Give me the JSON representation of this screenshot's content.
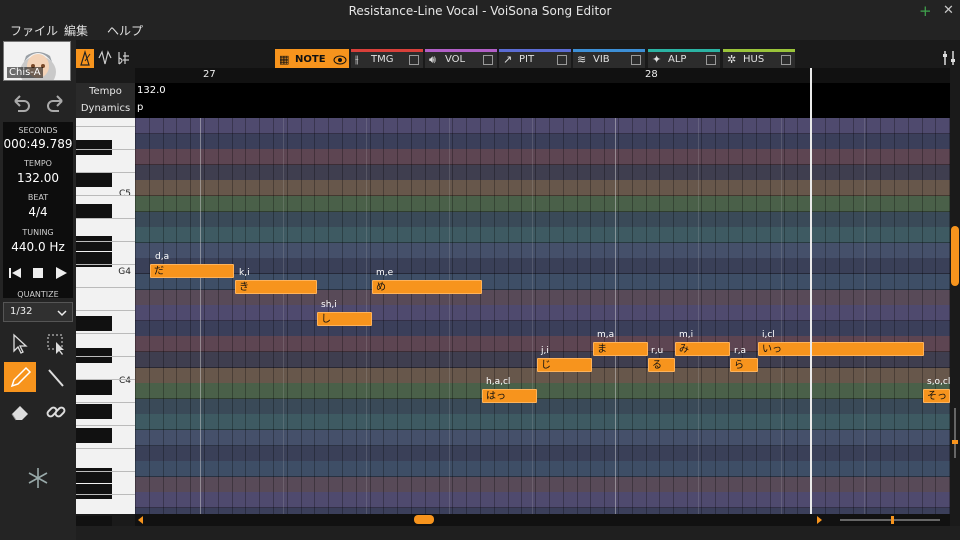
{
  "window": {
    "title": "Resistance-Line Vocal - VoiSona Song Editor",
    "minimize_glyph": "+",
    "close_glyph": "✕"
  },
  "menu": {
    "items": [
      "ファイル",
      "編集",
      "ヘルプ"
    ]
  },
  "singer": {
    "name": "Chis-A"
  },
  "info": {
    "seconds_label": "SECONDS",
    "seconds": "000:49.789",
    "tempo_label": "TEMPO",
    "tempo": "132.00",
    "beat_label": "BEAT",
    "beat": "4/4",
    "tuning_label": "TUNING",
    "tuning": "440.0 Hz"
  },
  "quantize": {
    "label": "QUANTIZE",
    "value": "1/32"
  },
  "tabs": [
    {
      "label": "NOTE",
      "color": "#f7941d"
    },
    {
      "label": "TMG",
      "color": "#d9403a"
    },
    {
      "label": "VOL",
      "color": "#b15fc7"
    },
    {
      "label": "PIT",
      "color": "#5b6cd4"
    },
    {
      "label": "VIB",
      "color": "#3d8fd6"
    },
    {
      "label": "ALP",
      "color": "#2bb3a3"
    },
    {
      "label": "HUS",
      "color": "#9ac43a"
    }
  ],
  "ruler": {
    "bars": [
      "27",
      "28"
    ]
  },
  "tracks": {
    "tempo_label": "Tempo",
    "tempo_value": "132.0",
    "dynamics_label": "Dynamics",
    "dynamics_value": "p"
  },
  "keyboard": {
    "labels": [
      "C5",
      "G4",
      "C4"
    ]
  },
  "notes": [
    {
      "lyric": "だ",
      "phonemes": "d,a"
    },
    {
      "lyric": "き",
      "phonemes": "k,i"
    },
    {
      "lyric": "め",
      "phonemes": "m,e"
    },
    {
      "lyric": "し",
      "phonemes": "sh,i"
    },
    {
      "lyric": "じ",
      "phonemes": "j,i"
    },
    {
      "lyric": "ま",
      "phonemes": "m,a"
    },
    {
      "lyric": "る",
      "phonemes": "r,u"
    },
    {
      "lyric": "み",
      "phonemes": "m,i"
    },
    {
      "lyric": "ら",
      "phonemes": "r,a"
    },
    {
      "lyric": "いっ",
      "phonemes": "i,cl"
    },
    {
      "lyric": "はっ",
      "phonemes": "h,a,cl"
    },
    {
      "lyric": "そっ",
      "phonemes": "s,o,cl"
    }
  ]
}
